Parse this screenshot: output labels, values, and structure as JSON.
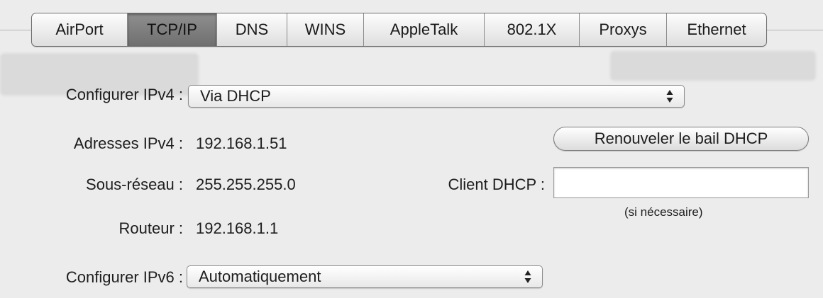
{
  "tabs": [
    {
      "label": "AirPort",
      "active": false
    },
    {
      "label": "TCP/IP",
      "active": true
    },
    {
      "label": "DNS",
      "active": false
    },
    {
      "label": "WINS",
      "active": false
    },
    {
      "label": "AppleTalk",
      "active": false
    },
    {
      "label": "802.1X",
      "active": false
    },
    {
      "label": "Proxys",
      "active": false
    },
    {
      "label": "Ethernet",
      "active": false
    }
  ],
  "ipv4": {
    "configure_label": "Configurer IPv4 :",
    "configure_value": "Via DHCP",
    "address_label": "Adresses IPv4 :",
    "address_value": "192.168.1.51",
    "subnet_label": "Sous-réseau :",
    "subnet_value": "255.255.255.0",
    "router_label": "Routeur :",
    "router_value": "192.168.1.1"
  },
  "dhcp": {
    "renew_button": "Renouveler le bail DHCP",
    "client_label": "Client DHCP :",
    "client_value": "",
    "client_hint": "(si nécessaire)"
  },
  "ipv6": {
    "configure_label": "Configurer IPv6 :",
    "configure_value": "Automatiquement"
  },
  "icons": {
    "popup_arrows": "up-down-arrows-icon"
  }
}
